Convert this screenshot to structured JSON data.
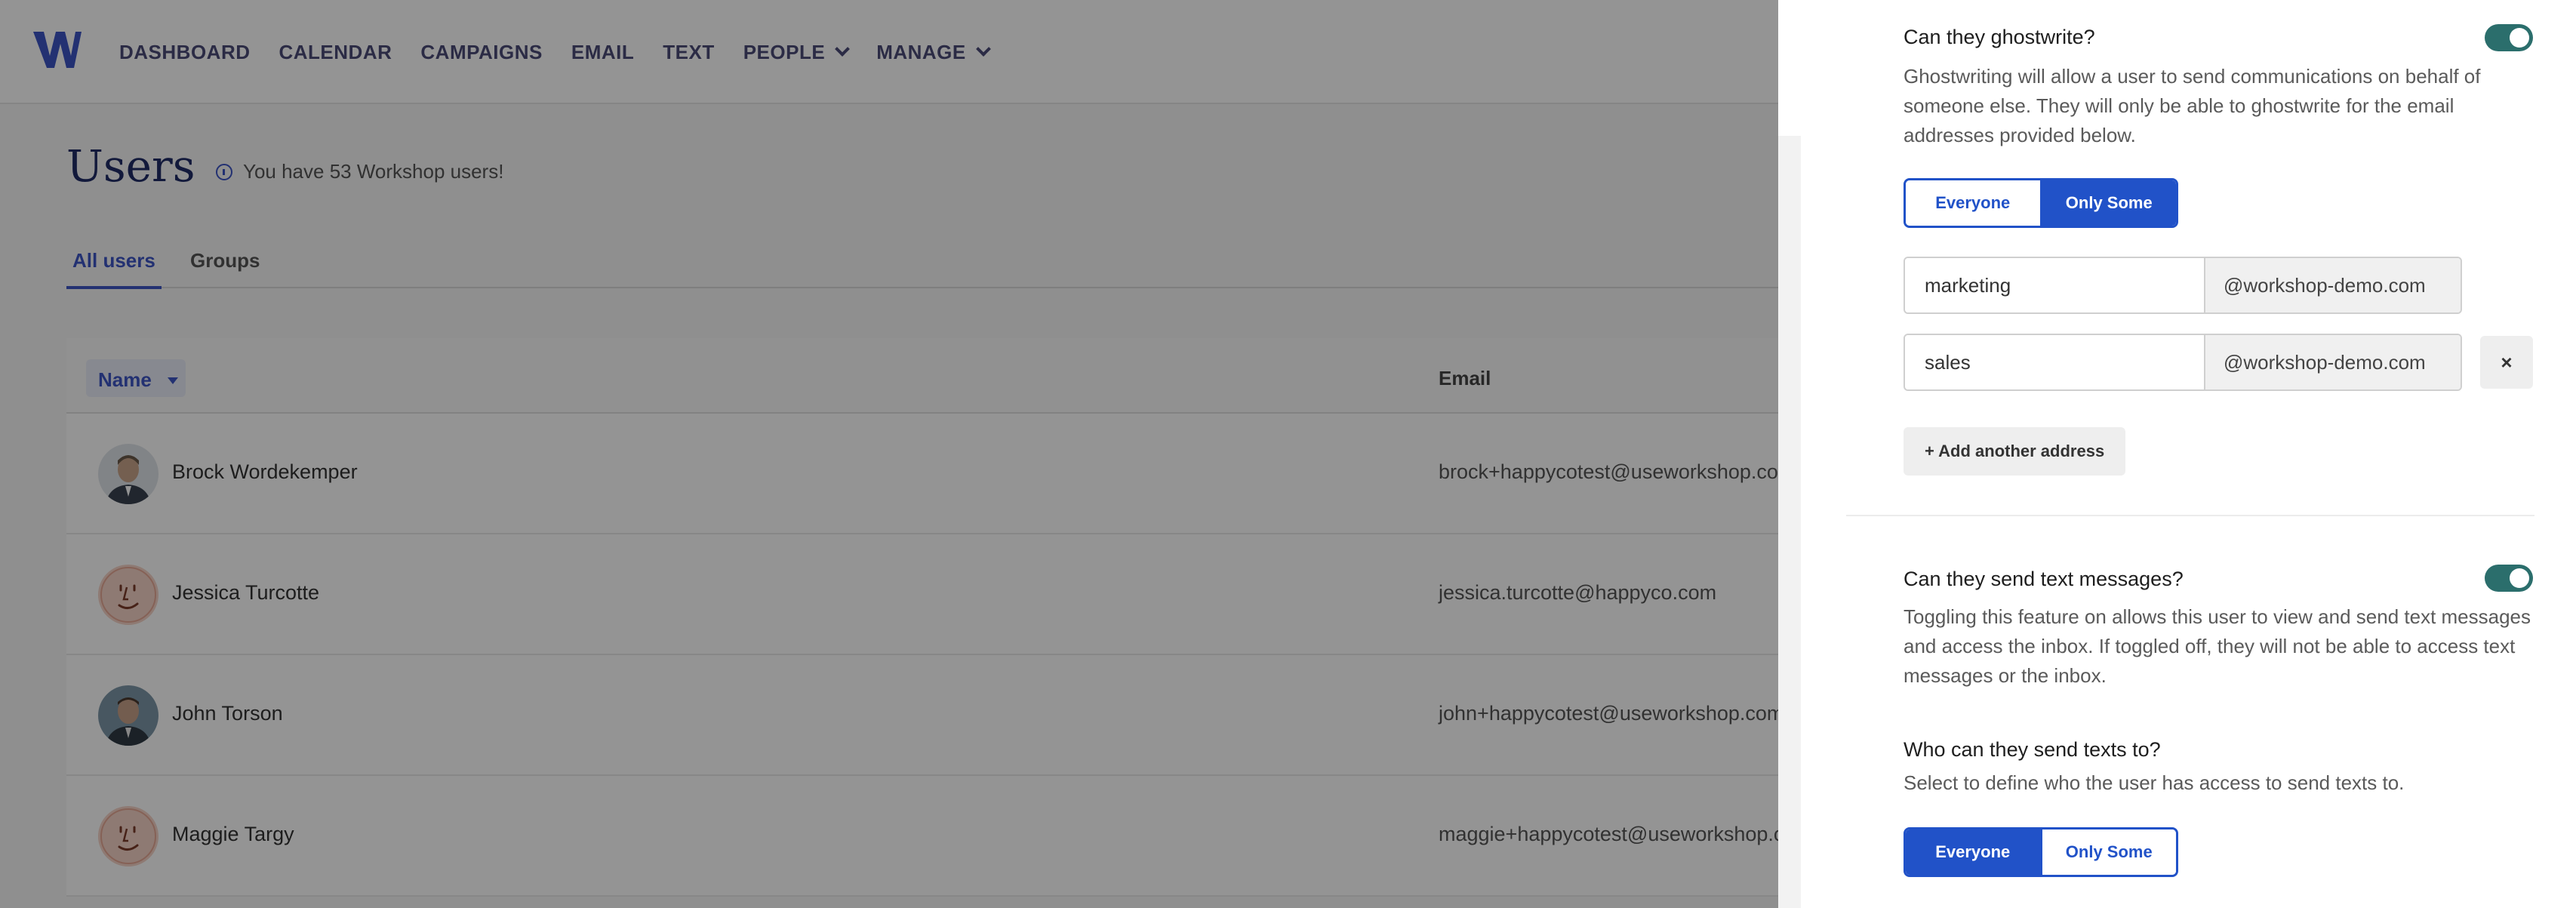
{
  "nav": {
    "logo_icon": "workshop-w-logo",
    "links": [
      "DASHBOARD",
      "CALENDAR",
      "CAMPAIGNS",
      "EMAIL",
      "TEXT",
      "PEOPLE",
      "MANAGE"
    ]
  },
  "page": {
    "title": "Users",
    "note": "You have 53 Workshop users!"
  },
  "tabs": [
    "All users",
    "Groups"
  ],
  "table": {
    "headers": {
      "name": "Name",
      "email": "Email"
    },
    "rows": [
      {
        "name": "Brock Wordekemper",
        "email": "brock+happycotest@useworkshop.com",
        "avatar": "photo"
      },
      {
        "name": "Jessica Turcotte",
        "email": "jessica.turcotte@happyco.com",
        "avatar": "placeholder-face"
      },
      {
        "name": "John Torson",
        "email": "john+happycotest@useworkshop.com",
        "avatar": "photo"
      },
      {
        "name": "Maggie Targy",
        "email": "maggie+happycotest@useworkshop.com",
        "avatar": "placeholder-face"
      }
    ]
  },
  "panel": {
    "ghostwrite": {
      "question": "Can they ghostwrite?",
      "enabled": true,
      "description": "Ghostwriting will allow a user to send communications on behalf of someone else. They will only be able to ghostwrite for the email addresses provided below.",
      "options": [
        "Everyone",
        "Only Some"
      ],
      "selected": "Only Some",
      "addresses": [
        {
          "local": "marketing",
          "domain": "@workshop-demo.com"
        },
        {
          "local": "sales",
          "domain": "@workshop-demo.com"
        }
      ],
      "remove_label": "×",
      "add_label": "+ Add another address"
    },
    "texting": {
      "question": "Can they send text messages?",
      "enabled": true,
      "description": "Toggling this feature on allows this user to view and send text messages and access the inbox. If toggled off, they will not be able to access text messages or the inbox."
    },
    "text_recipients": {
      "question": "Who can they send texts to?",
      "description": "Select to define who the user has access to send texts to.",
      "options": [
        "Everyone",
        "Only Some"
      ],
      "selected": "Everyone"
    }
  },
  "colors": {
    "accent": "#2152c8",
    "toggle_on": "#2b6e6c",
    "nav_text": "#4b4b78",
    "title": "#1f2b66"
  }
}
